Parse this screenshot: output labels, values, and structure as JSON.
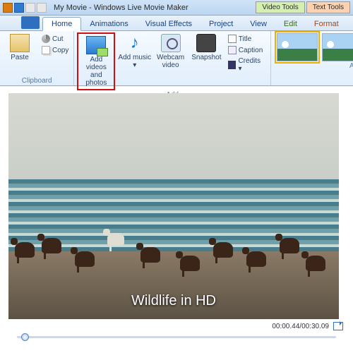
{
  "window": {
    "title": "My Movie - Windows Live Movie Maker"
  },
  "context_tabs": {
    "video": "Video Tools",
    "text": "Text Tools"
  },
  "tabs": [
    "Home",
    "Animations",
    "Visual Effects",
    "Project",
    "View",
    "Edit",
    "Format"
  ],
  "active_tab": "Home",
  "clipboard": {
    "paste": "Paste",
    "cut": "Cut",
    "copy": "Copy",
    "group": "Clipboard"
  },
  "add": {
    "videos_photos": "Add videos and photos",
    "music": "Add music",
    "webcam": "Webcam video",
    "snapshot": "Snapshot",
    "title": "Title",
    "caption": "Caption",
    "credits": "Credits",
    "group": "Add"
  },
  "automovie": {
    "group": "AutoMovie themes"
  },
  "preview": {
    "caption": "Wildlife in HD"
  },
  "playback": {
    "position": "00:00.44",
    "duration": "00:30.09"
  }
}
